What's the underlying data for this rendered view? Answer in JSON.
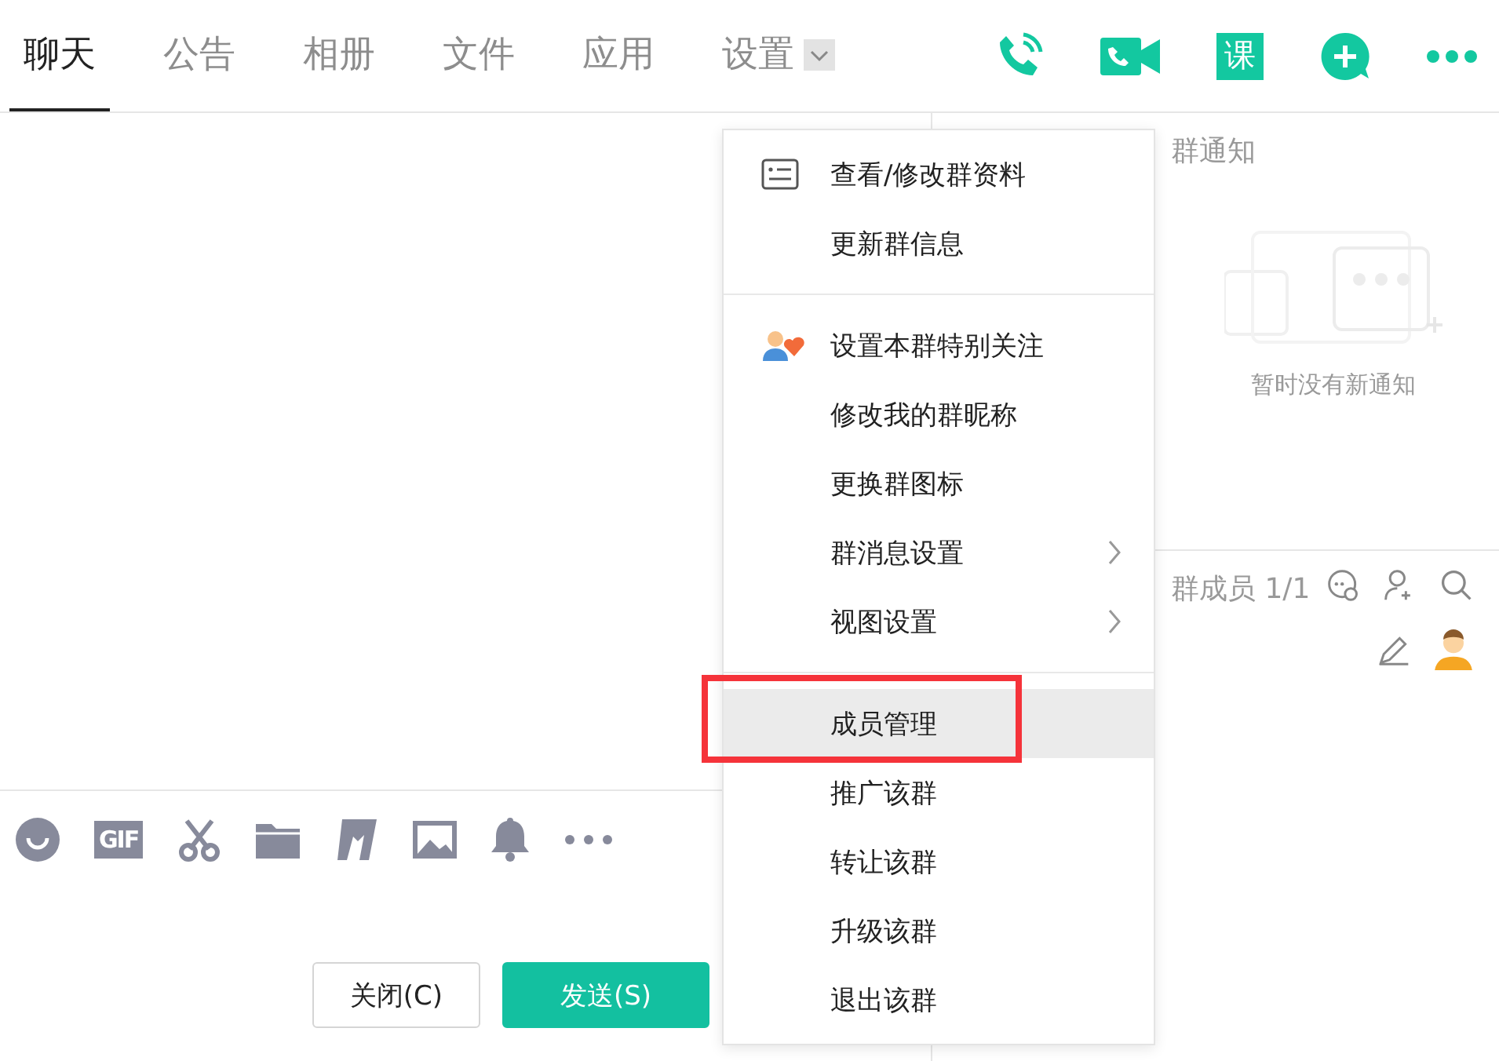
{
  "tabs": [
    {
      "label": "聊天",
      "selected": true,
      "dropdown": false
    },
    {
      "label": "公告",
      "selected": false,
      "dropdown": false
    },
    {
      "label": "相册",
      "selected": false,
      "dropdown": false
    },
    {
      "label": "文件",
      "selected": false,
      "dropdown": false
    },
    {
      "label": "应用",
      "selected": false,
      "dropdown": false
    },
    {
      "label": "设置",
      "selected": false,
      "dropdown": true
    }
  ],
  "header_actions": [
    {
      "kind": "voice"
    },
    {
      "kind": "video"
    },
    {
      "kind": "lesson",
      "label": "课"
    },
    {
      "kind": "add"
    },
    {
      "kind": "more"
    }
  ],
  "toolbar": [
    {
      "kind": "emoji"
    },
    {
      "kind": "gif",
      "label": "GIF"
    },
    {
      "kind": "cut"
    },
    {
      "kind": "folder"
    },
    {
      "kind": "shake"
    },
    {
      "kind": "image"
    },
    {
      "kind": "bell"
    },
    {
      "kind": "more"
    }
  ],
  "buttons": [
    {
      "label": "关闭(C)",
      "primary": false
    },
    {
      "label": "发送(S)",
      "primary": true
    }
  ],
  "notice": {
    "title": "群通知",
    "empty_text": "暂时没有新通知"
  },
  "members": {
    "title": "群成员 1/1"
  },
  "menu": {
    "groups": [
      [
        {
          "label": "查看/修改群资料",
          "has_submenu": false,
          "selected": false
        },
        {
          "label": "更新群信息",
          "has_submenu": false,
          "selected": false
        }
      ],
      [
        {
          "label": "设置本群特别关注",
          "has_submenu": false,
          "selected": false
        },
        {
          "label": "修改我的群昵称",
          "has_submenu": false,
          "selected": false
        },
        {
          "label": "更换群图标",
          "has_submenu": false,
          "selected": false
        },
        {
          "label": "群消息设置",
          "has_submenu": true,
          "selected": false
        },
        {
          "label": "视图设置",
          "has_submenu": true,
          "selected": false
        }
      ],
      [
        {
          "label": "成员管理",
          "has_submenu": false,
          "selected": true
        },
        {
          "label": "推广该群",
          "has_submenu": false,
          "selected": false
        },
        {
          "label": "转让该群",
          "has_submenu": false,
          "selected": false
        },
        {
          "label": "升级该群",
          "has_submenu": false,
          "selected": false
        },
        {
          "label": "退出该群",
          "has_submenu": false,
          "selected": false
        }
      ]
    ]
  }
}
